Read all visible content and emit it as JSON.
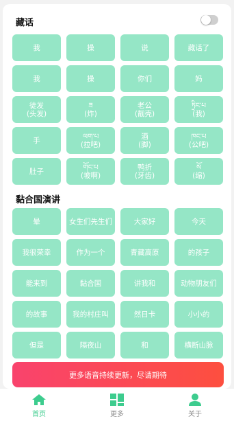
{
  "sections": {
    "tibetan": {
      "title": "藏话"
    },
    "speech": {
      "title": "黏合国演讲"
    }
  },
  "toggle": {
    "on": false
  },
  "grid1": [
    [
      "我"
    ],
    [
      "操"
    ],
    [
      "说"
    ],
    [
      "藏话了"
    ],
    [
      "我"
    ],
    [
      "操"
    ],
    [
      "你们"
    ],
    [
      "妈"
    ],
    [
      "徒发",
      "(头发)"
    ],
    [
      "ཟ",
      "(炸)"
    ],
    [
      "老公",
      "(靓壳)"
    ],
    [
      "ཏྲིང་པ",
      "(我)"
    ],
    [
      "手"
    ],
    [
      "ལག་པ",
      "(拉吧)"
    ],
    [
      "酒",
      "(脚)"
    ],
    [
      "ཁང་པ",
      "(公吧)"
    ],
    [
      "肚子"
    ],
    [
      "གོང་པ",
      "(坡啊)"
    ],
    [
      "鸭折",
      "(牙齿)"
    ],
    [
      "སོ",
      "(缩)"
    ]
  ],
  "grid2": [
    [
      "晕"
    ],
    [
      "女生们先生们"
    ],
    [
      "大家好"
    ],
    [
      "今天"
    ],
    [
      "我很荣幸"
    ],
    [
      "作为一个"
    ],
    [
      "青藏高原"
    ],
    [
      "的孩子"
    ],
    [
      "能来到"
    ],
    [
      "黏合国"
    ],
    [
      "讲我和"
    ],
    [
      "动物朋友们"
    ],
    [
      "的故事"
    ],
    [
      "我的村庄叫"
    ],
    [
      "然日卡"
    ],
    [
      "小小的"
    ],
    [
      "但是"
    ],
    [
      "隔夜山"
    ],
    [
      "和"
    ],
    [
      "横断山脉"
    ]
  ],
  "banner": {
    "text": "更多语音持续更新，尽请期待"
  },
  "tabs": [
    {
      "label": "首页",
      "icon": "home-icon",
      "active": true
    },
    {
      "label": "更多",
      "icon": "grid-icon",
      "active": false
    },
    {
      "label": "关于",
      "icon": "user-icon",
      "active": false
    }
  ],
  "colors": {
    "tile": "#95e6c6",
    "accent": "#3dcc8e",
    "banner_start": "#f9436d",
    "banner_end": "#fd4f3f"
  }
}
